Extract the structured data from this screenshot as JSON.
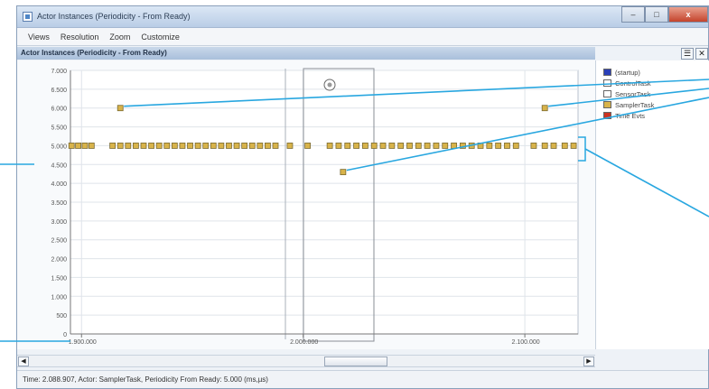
{
  "window": {
    "title": "Actor Instances (Periodicity - From Ready)",
    "controls": {
      "minimize": "–",
      "maximize": "□",
      "close": "x"
    }
  },
  "menu": {
    "items": [
      "Views",
      "Resolution",
      "Zoom",
      "Customize"
    ]
  },
  "panel": {
    "title": "Actor Instances (Periodicity - From Ready)",
    "list_button": "☰",
    "close_button": "✕"
  },
  "legend": {
    "items": [
      {
        "label": "(startup)",
        "color": "#2a3fb8"
      },
      {
        "label": "ControlTask",
        "color": "#ffffff"
      },
      {
        "label": "SensorTask",
        "color": "#ffffff"
      },
      {
        "label": "SamplerTask",
        "color": "#d8b34a"
      },
      {
        "label": "Time Evts",
        "color": "#cc3322"
      }
    ]
  },
  "chart_data": {
    "type": "scatter",
    "y_ticks": [
      "7.000",
      "6.500",
      "6.000",
      "5.500",
      "5.000",
      "4.500",
      "4.000",
      "3.500",
      "3.000",
      "2.500",
      "2.000",
      "1.500",
      "1.000",
      "500",
      "0"
    ],
    "y_tick_values": [
      7000,
      6500,
      6000,
      5500,
      5000,
      4500,
      4000,
      3500,
      3000,
      2500,
      2000,
      1500,
      1000,
      500,
      0
    ],
    "x_ticks": [
      "1.900.000",
      "2.000.000",
      "2.100.000"
    ],
    "x_tick_values": [
      1900000,
      2000000,
      2100000
    ],
    "ylim": [
      0,
      7000
    ],
    "xlim": [
      1895000,
      2124000
    ],
    "grid": true,
    "selected_range": [
      2007000,
      2037000
    ],
    "series": [
      {
        "name": "SamplerTask",
        "color": "#d8b34a",
        "x": [
          1895500,
          1898500,
          1901500,
          1904500,
          1914000,
          1917500,
          1921000,
          1924500,
          1928000,
          1931500,
          1935000,
          1938500,
          1942000,
          1945500,
          1949000,
          1952500,
          1956000,
          1959500,
          1963000,
          1966500,
          1970000,
          1973500,
          1977000,
          1980500,
          1984000,
          1987500,
          1994000,
          2002000,
          2012000,
          2016000,
          2020000,
          2024000,
          2028000,
          2032000,
          2036000,
          2040000,
          2044000,
          2048000,
          2052000,
          2056000,
          2060000,
          2064000,
          2068000,
          2072000,
          2076000,
          2080000,
          2084000,
          2088000,
          2092000,
          2096000,
          2104000,
          2109000,
          2113000,
          2118000,
          2122000,
          1917500,
          2018000,
          2109000
        ],
        "y": [
          5000,
          5000,
          5000,
          5000,
          5000,
          5000,
          5000,
          5000,
          5000,
          5000,
          5000,
          5000,
          5000,
          5000,
          5000,
          5000,
          5000,
          5000,
          5000,
          5000,
          5000,
          5000,
          5000,
          5000,
          5000,
          5000,
          5000,
          5000,
          5000,
          5000,
          5000,
          5000,
          5000,
          5000,
          5000,
          5000,
          5000,
          5000,
          5000,
          5000,
          5000,
          5000,
          5000,
          5000,
          5000,
          5000,
          5000,
          5000,
          5000,
          5000,
          5000,
          5000,
          5000,
          5000,
          5000,
          6000,
          4300,
          6000
        ]
      }
    ]
  },
  "status": {
    "text": "Time: 2.088.907, Actor: SamplerTask, Periodicity From Ready: 5.000 (ms,µs)"
  }
}
